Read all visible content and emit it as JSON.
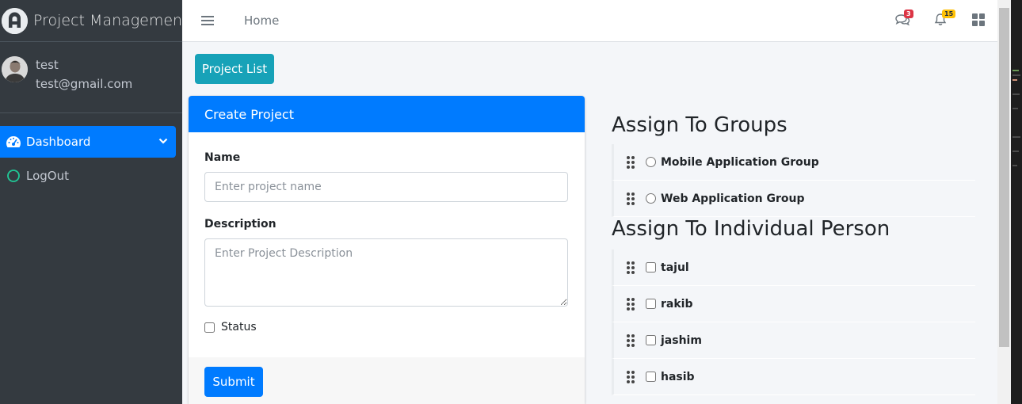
{
  "app": {
    "brand_title": "Project Management"
  },
  "user": {
    "name": "test",
    "email": "test@gmail.com"
  },
  "sidebar": {
    "items": [
      {
        "label": "Dashboard",
        "active": true,
        "icon": "tachometer-icon"
      },
      {
        "label": "LogOut",
        "active": false,
        "icon": "circle-outline-icon"
      }
    ]
  },
  "header": {
    "home_label": "Home",
    "messages_count": "3",
    "notifications_count": "15"
  },
  "toolbar": {
    "project_list_label": "Project List"
  },
  "form": {
    "title": "Create Project",
    "name_label": "Name",
    "name_placeholder": "Enter project name",
    "name_value": "",
    "description_label": "Description",
    "description_placeholder": "Enter Project Description",
    "description_value": "",
    "status_label": "Status",
    "status_checked": false,
    "submit_label": "Submit"
  },
  "assign": {
    "groups_title": "Assign To Groups",
    "groups": [
      "Mobile Application Group",
      "Web Application Group"
    ],
    "persons_title": "Assign To Individual Person",
    "persons": [
      "tajul",
      "rakib",
      "jashim",
      "hasib"
    ]
  },
  "colors": {
    "primary": "#007bff",
    "info": "#17a2b8",
    "sidebar_bg": "#343a40",
    "danger": "#dc3545",
    "warning": "#ffc107"
  }
}
